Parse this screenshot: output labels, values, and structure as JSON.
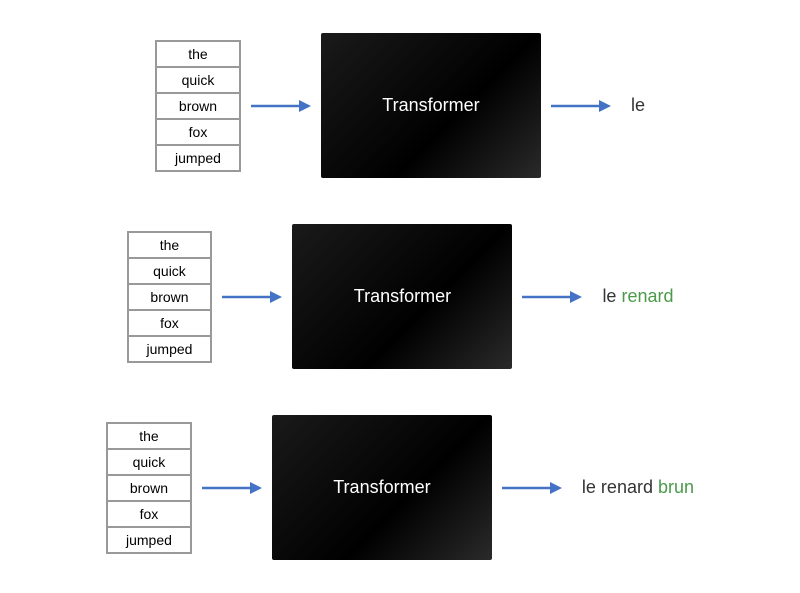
{
  "rows": [
    {
      "id": "row1",
      "words": [
        "the",
        "quick",
        "brown",
        "fox",
        "jumped"
      ],
      "highlighted_index": 2,
      "transformer_label": "Transformer",
      "output_prefix": "le",
      "output_new": "",
      "arrow_label": "arrow"
    },
    {
      "id": "row2",
      "words": [
        "the",
        "quick",
        "brown",
        "fox",
        "jumped"
      ],
      "highlighted_index": 3,
      "transformer_label": "Transformer",
      "output_prefix": "le ",
      "output_new": "renard",
      "arrow_label": "arrow"
    },
    {
      "id": "row3",
      "words": [
        "the",
        "quick",
        "brown",
        "fox",
        "jumped"
      ],
      "highlighted_index": 1,
      "transformer_label": "Transformer",
      "output_prefix": "le renard ",
      "output_new": "brun",
      "arrow_label": "arrow"
    }
  ]
}
